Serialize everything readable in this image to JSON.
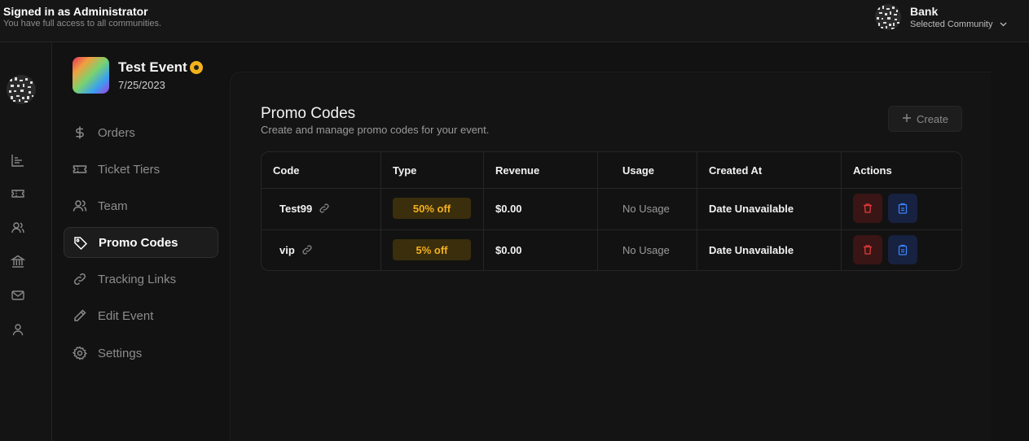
{
  "header": {
    "signed_in": "Signed in as Administrator",
    "access": "You have full access to all communities.",
    "community_name": "Bank",
    "community_sub": "Selected Community"
  },
  "rail": {
    "icons": [
      "chart-icon",
      "ticket-icon",
      "users-icon",
      "bank-icon",
      "mail-icon",
      "user-icon"
    ]
  },
  "event": {
    "title": "Test Event",
    "date": "7/25/2023"
  },
  "sidebar": {
    "items": [
      {
        "label": "Orders",
        "icon": "dollar-icon",
        "active": false
      },
      {
        "label": "Ticket Tiers",
        "icon": "ticket-icon",
        "active": false
      },
      {
        "label": "Team",
        "icon": "users-icon",
        "active": false
      },
      {
        "label": "Promo Codes",
        "icon": "tag-icon",
        "active": true
      },
      {
        "label": "Tracking Links",
        "icon": "link-icon",
        "active": false
      },
      {
        "label": "Edit Event",
        "icon": "pencil-icon",
        "active": false
      },
      {
        "label": "Settings",
        "icon": "gear-icon",
        "active": false
      }
    ]
  },
  "main": {
    "title": "Promo Codes",
    "subtitle": "Create and manage promo codes for your event.",
    "create_label": "Create",
    "columns": [
      "Code",
      "Type",
      "Revenue",
      "Usage",
      "Created At",
      "Actions"
    ],
    "rows": [
      {
        "code": "Test99",
        "type": "50% off",
        "revenue": "$0.00",
        "usage": "No Usage",
        "created": "Date Unavailable"
      },
      {
        "code": "vip",
        "type": "5% off",
        "revenue": "$0.00",
        "usage": "No Usage",
        "created": "Date Unavailable"
      }
    ]
  },
  "colors": {
    "accent_gold": "#f5b01e",
    "delete_red": "#e23b3b",
    "copy_blue": "#3b82f6"
  }
}
